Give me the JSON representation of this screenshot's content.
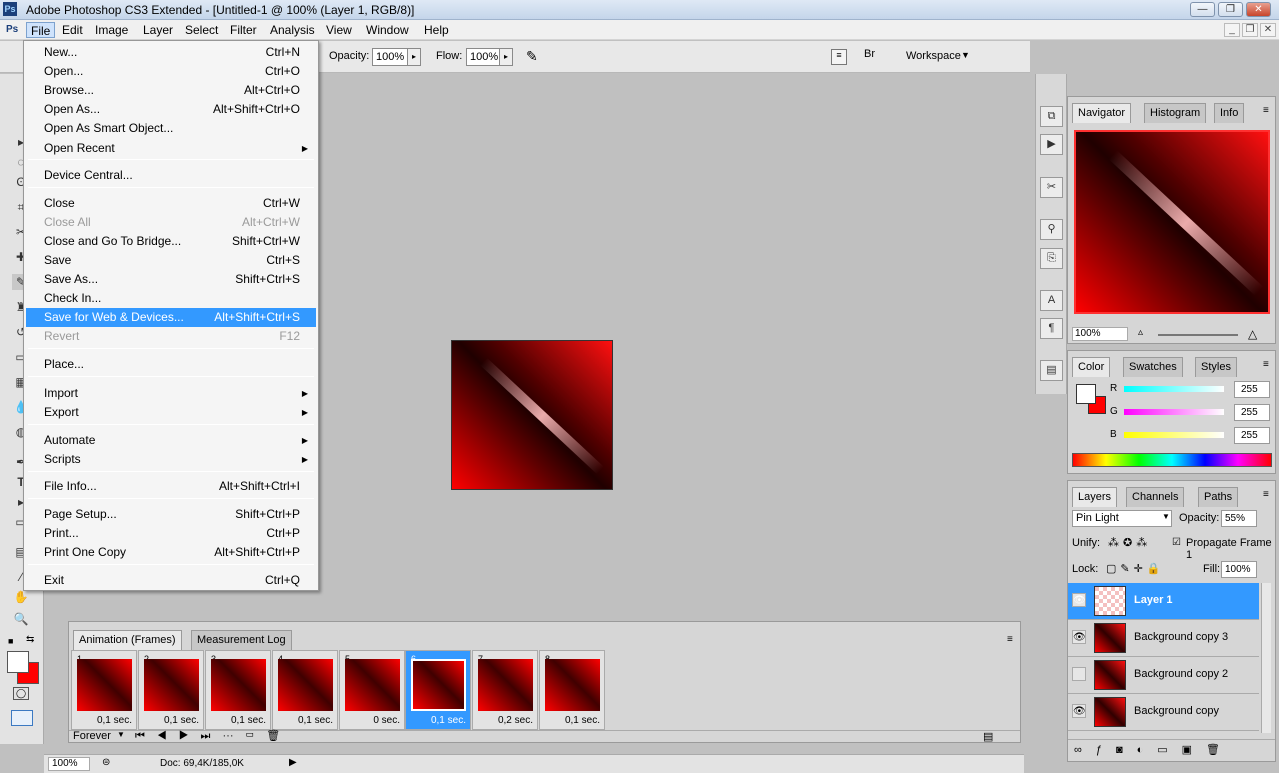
{
  "window": {
    "title": "Adobe Photoshop CS3 Extended - [Untitled-1 @ 100% (Layer 1, RGB/8)]",
    "app_icon": "Ps"
  },
  "menubar": [
    "File",
    "Edit",
    "Image",
    "Layer",
    "Select",
    "Filter",
    "Analysis",
    "View",
    "Window",
    "Help"
  ],
  "options": {
    "opacity_label": "Opacity:",
    "opacity": "100%",
    "flow_label": "Flow:",
    "flow": "100%",
    "workspace": "Workspace"
  },
  "file_menu": [
    {
      "label": "New...",
      "shortcut": "Ctrl+N"
    },
    {
      "label": "Open...",
      "shortcut": "Ctrl+O"
    },
    {
      "label": "Browse...",
      "shortcut": "Alt+Ctrl+O"
    },
    {
      "label": "Open As...",
      "shortcut": "Alt+Shift+Ctrl+O"
    },
    {
      "label": "Open As Smart Object...",
      "shortcut": ""
    },
    {
      "label": "Open Recent",
      "shortcut": ""
    },
    {
      "label": "Device Central...",
      "shortcut": ""
    },
    {
      "label": "Close",
      "shortcut": "Ctrl+W"
    },
    {
      "label": "Close All",
      "shortcut": "Alt+Ctrl+W"
    },
    {
      "label": "Close and Go To Bridge...",
      "shortcut": "Shift+Ctrl+W"
    },
    {
      "label": "Save",
      "shortcut": "Ctrl+S"
    },
    {
      "label": "Save As...",
      "shortcut": "Shift+Ctrl+S"
    },
    {
      "label": "Check In...",
      "shortcut": ""
    },
    {
      "label": "Save for Web & Devices...",
      "shortcut": "Alt+Shift+Ctrl+S"
    },
    {
      "label": "Revert",
      "shortcut": "F12"
    },
    {
      "label": "Place...",
      "shortcut": ""
    },
    {
      "label": "Import",
      "shortcut": ""
    },
    {
      "label": "Export",
      "shortcut": ""
    },
    {
      "label": "Automate",
      "shortcut": ""
    },
    {
      "label": "Scripts",
      "shortcut": ""
    },
    {
      "label": "File Info...",
      "shortcut": "Alt+Shift+Ctrl+I"
    },
    {
      "label": "Page Setup...",
      "shortcut": "Shift+Ctrl+P"
    },
    {
      "label": "Print...",
      "shortcut": "Ctrl+P"
    },
    {
      "label": "Print One Copy",
      "shortcut": "Alt+Shift+Ctrl+P"
    },
    {
      "label": "Exit",
      "shortcut": "Ctrl+Q"
    }
  ],
  "navigator": {
    "tabs": [
      "Navigator",
      "Histogram",
      "Info"
    ],
    "zoom": "100%"
  },
  "color": {
    "tabs": [
      "Color",
      "Swatches",
      "Styles"
    ],
    "channels": [
      {
        "name": "R",
        "value": "255"
      },
      {
        "name": "G",
        "value": "255"
      },
      {
        "name": "B",
        "value": "255"
      }
    ]
  },
  "layers": {
    "tabs": [
      "Layers",
      "Channels",
      "Paths"
    ],
    "blend_mode": "Pin Light",
    "opacity_label": "Opacity:",
    "opacity": "55%",
    "unify_label": "Unify:",
    "propagate": "Propagate Frame 1",
    "lock_label": "Lock:",
    "fill_label": "Fill:",
    "fill": "100%",
    "items": [
      "Layer 1",
      "Background copy 3",
      "Background copy 2",
      "Background copy"
    ]
  },
  "animation": {
    "tabs": [
      "Animation (Frames)",
      "Measurement Log"
    ],
    "frames": [
      {
        "num": "1",
        "delay": "0,1 sec."
      },
      {
        "num": "2",
        "delay": "0,1 sec."
      },
      {
        "num": "3",
        "delay": "0,1 sec."
      },
      {
        "num": "4",
        "delay": "0,1 sec."
      },
      {
        "num": "5",
        "delay": "0 sec."
      },
      {
        "num": "6",
        "delay": "0,1 sec."
      },
      {
        "num": "7",
        "delay": "0,2 sec."
      },
      {
        "num": "8",
        "delay": "0,1 sec."
      }
    ],
    "loop": "Forever"
  },
  "status": {
    "zoom": "100%",
    "doc": "Doc: 69,4K/185,0K"
  }
}
